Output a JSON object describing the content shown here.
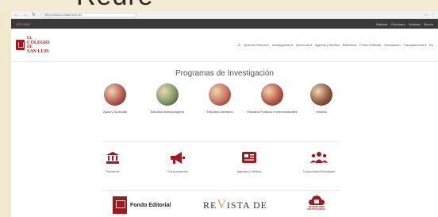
{
  "frame": {
    "overlay_word": "Redre"
  },
  "browser": {
    "url": "https://www.colsan.edu.mx",
    "nav_icons": [
      "back-icon",
      "forward-icon",
      "reload-icon",
      "lock-icon"
    ]
  },
  "topbar": {
    "left": "UTS 2023",
    "links": [
      "Noticias",
      "Directorio",
      "Noticias",
      "Buzón"
    ]
  },
  "logo": {
    "line1": "EL",
    "line2": "COLEGIO",
    "line3": "DE",
    "line4": "SAN LUIS"
  },
  "menu": {
    "items": [
      "Quiénes Somos ▾",
      "Investigación ▾",
      "Docencia ▾",
      "Agenda y Medios",
      "Biblioteca",
      "Fondo Editorial",
      "Vinculación",
      "Transparencia ▾",
      "Bu"
    ]
  },
  "section_title": "Programas de Investigación",
  "programs": [
    {
      "label": "Agua y Sociedad",
      "color": "#b65a54"
    },
    {
      "label": "Estudios Antropológicos",
      "color": "#7c9c6a"
    },
    {
      "label": "Estudios Literarios",
      "color": "#c7725e"
    },
    {
      "label": "Estudios Políticos e Internacionales",
      "color": "#b9584c"
    },
    {
      "label": "Historia",
      "color": "#8d5a44"
    }
  ],
  "services": [
    {
      "label": "Docencia",
      "icon": "institution-icon"
    },
    {
      "label": "Convocatorias",
      "icon": "megaphone-icon"
    },
    {
      "label": "Agenda y Medios",
      "icon": "newspaper-icon"
    },
    {
      "label": "Comunidad Estudiantil",
      "icon": "users-icon"
    }
  ],
  "bottom": {
    "fondo_label": "Fondo Editorial",
    "fondo_sub": "EL COLEGIO DE SAN LUIS",
    "revista_pre": "RE",
    "revista_v": "V",
    "revista_post": "ISTA DE",
    "repo_line1": "REPOSITORIO",
    "repo_line2": "INSTITUCIONAL"
  },
  "accent": "#9c1b1e"
}
